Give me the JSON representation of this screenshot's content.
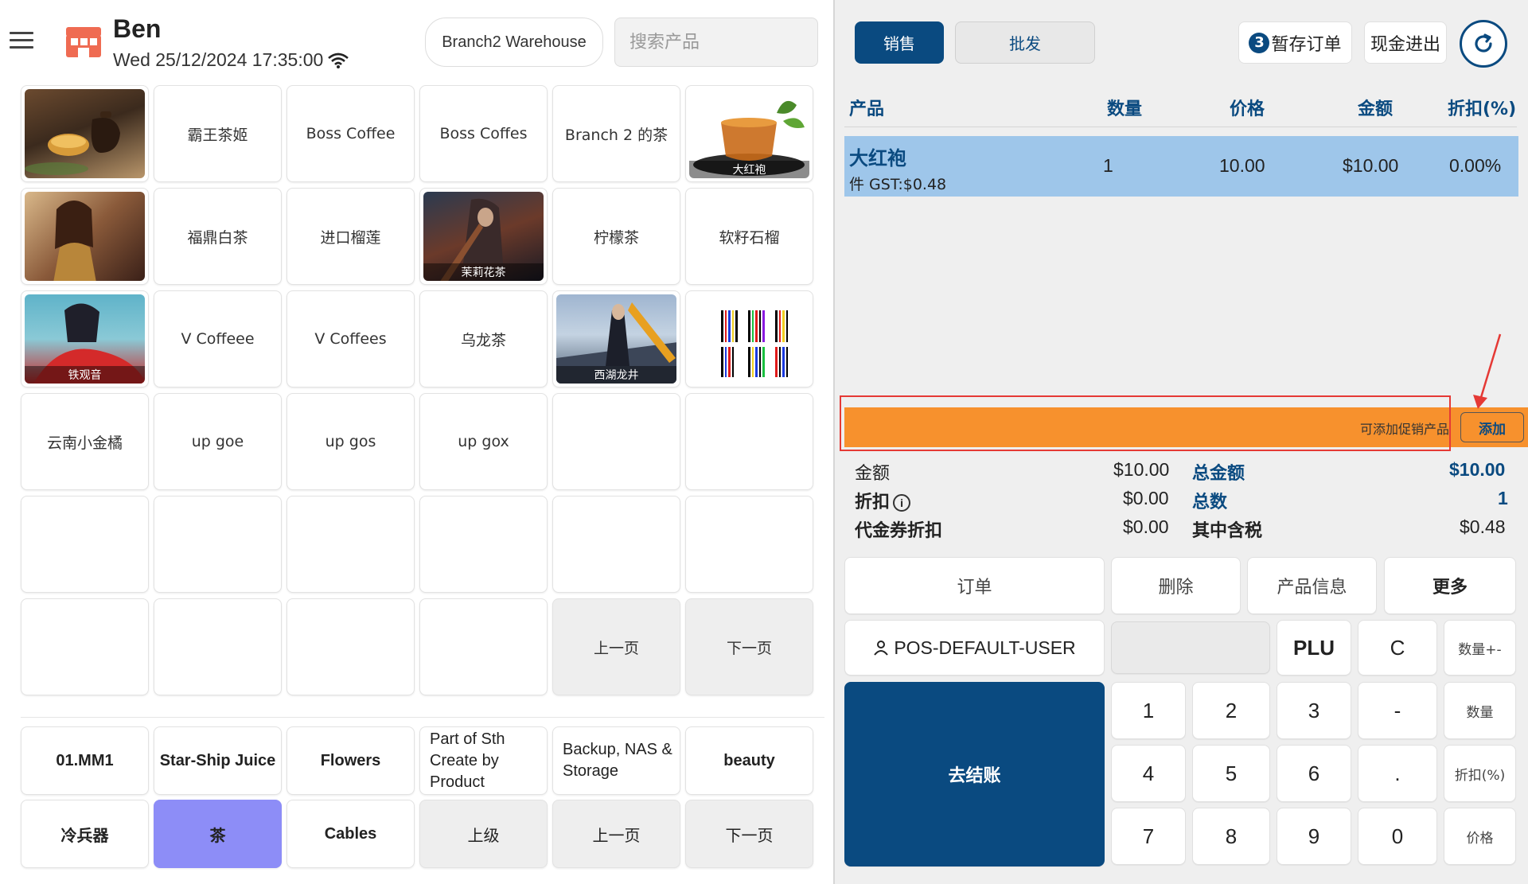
{
  "header": {
    "user_name": "Ben",
    "datetime": "Wed 25/12/2024 17:35:00",
    "branch": "Branch2 Warehouse",
    "search_placeholder": "搜索产品"
  },
  "products": [
    {
      "label": "",
      "caption": "",
      "image": "teapot"
    },
    {
      "label": "霸王茶姬"
    },
    {
      "label": "Boss Coffee"
    },
    {
      "label": "Boss Coffes"
    },
    {
      "label": "Branch 2 的茶"
    },
    {
      "label": "",
      "caption": "大红袍",
      "image": "tea-cup"
    },
    {
      "label": "",
      "caption": "",
      "image": "warrior-gold"
    },
    {
      "label": "福鼎白茶"
    },
    {
      "label": "进口榴莲"
    },
    {
      "label": "",
      "caption": "茉莉花茶",
      "image": "dark-warrior"
    },
    {
      "label": "柠檬茶"
    },
    {
      "label": "软籽石榴"
    },
    {
      "label": "",
      "caption": "铁观音",
      "image": "warrior-red"
    },
    {
      "label": "V Coffeee"
    },
    {
      "label": "V Coffees"
    },
    {
      "label": "乌龙茶"
    },
    {
      "label": "",
      "caption": "西湖龙井",
      "image": "blade-warrior"
    },
    {
      "label": "",
      "caption": "",
      "image": "barcode"
    },
    {
      "label": "云南小金橘"
    },
    {
      "label": "up goe"
    },
    {
      "label": "up gos"
    },
    {
      "label": "up gox"
    }
  ],
  "product_nav": {
    "prev": "上一页",
    "next": "下一页"
  },
  "categories": {
    "row1": [
      "01.MM1",
      "Star-Ship Juice",
      "Flowers",
      "Part of Sth Create by Product",
      "Backup, NAS & Storage",
      "beauty"
    ],
    "row2": [
      "冷兵器",
      "茶",
      "Cables",
      "上级",
      "上一页",
      "下一页"
    ]
  },
  "top": {
    "tab_sale": "销售",
    "tab_wholesale": "批发",
    "held_count": "3",
    "held_label": "暂存订单",
    "cash_label": "现金进出"
  },
  "table": {
    "headers": {
      "product": "产品",
      "qty": "数量",
      "price": "价格",
      "amount": "金额",
      "discount": "折扣(%)"
    },
    "rows": [
      {
        "name": "大红袍",
        "sub": "件 GST:$0.48",
        "qty": "1",
        "price": "10.00",
        "amount": "$10.00",
        "discount": "0.00%"
      }
    ]
  },
  "promo": {
    "text": "可添加促销产品",
    "add": "添加"
  },
  "summary": {
    "amount_label": "金额",
    "amount_value": "$10.00",
    "discount_label": "折扣",
    "discount_value": "$0.00",
    "voucher_label": "代金券折扣",
    "voucher_value": "$0.00",
    "total_label": "总金额",
    "total_value": "$10.00",
    "count_label": "总数",
    "count_value": "1",
    "tax_label": "其中含税",
    "tax_value": "$0.48"
  },
  "actions": {
    "order": "订单",
    "delete": "删除",
    "product_info": "产品信息",
    "more": "更多"
  },
  "keypad": {
    "user": "POS-DEFAULT-USER",
    "plu": "PLU",
    "clear": "C",
    "qty_pm": "数量+-",
    "qty": "数量",
    "discount": "折扣(%)",
    "price": "价格",
    "checkout": "去结账",
    "k1": "1",
    "k2": "2",
    "k3": "3",
    "k4": "4",
    "k5": "5",
    "k6": "6",
    "k7": "7",
    "k8": "8",
    "k9": "9",
    "k0": "0",
    "minus": "-",
    "dot": "."
  },
  "colors": {
    "primary": "#0a4a80",
    "promo": "#f7912d",
    "selected_row": "#9ec6ea",
    "active_category": "#8d8df7",
    "annotation": "#e53935"
  }
}
